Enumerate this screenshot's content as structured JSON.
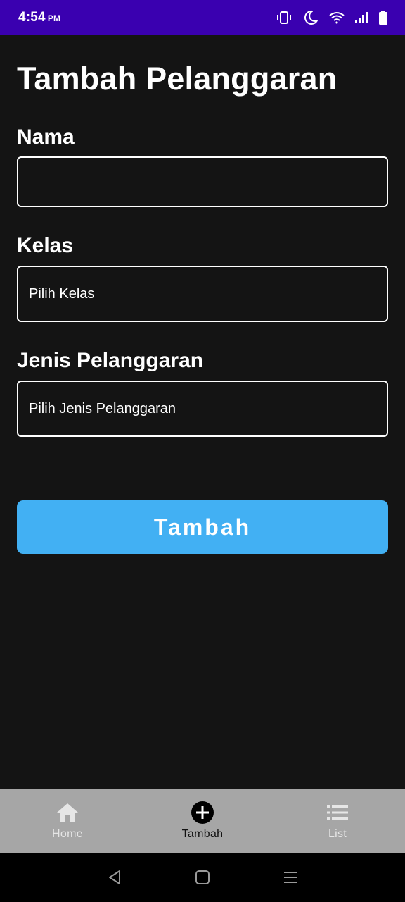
{
  "status_bar": {
    "time": "4:54",
    "ampm": "PM",
    "icons": [
      "vibrate-icon",
      "moon-icon",
      "wifi-icon",
      "signal-icon",
      "battery-icon"
    ],
    "background": "#3a00b0"
  },
  "page": {
    "title": "Tambah Pelanggaran"
  },
  "form": {
    "nama": {
      "label": "Nama",
      "value": ""
    },
    "kelas": {
      "label": "Kelas",
      "value": "Pilih Kelas"
    },
    "jenis": {
      "label": "Jenis Pelanggaran",
      "value": "Pilih Jenis Pelanggaran"
    },
    "submit_label": "Tambah",
    "accent": "#42b0f3"
  },
  "bottom_nav": {
    "items": [
      {
        "label": "Home",
        "icon": "home-icon",
        "active": false
      },
      {
        "label": "Tambah",
        "icon": "add-circle-icon",
        "active": true
      },
      {
        "label": "List",
        "icon": "list-icon",
        "active": false
      }
    ]
  },
  "system_nav": {
    "icons": [
      "back-icon",
      "home-square-icon",
      "menu-icon"
    ]
  }
}
